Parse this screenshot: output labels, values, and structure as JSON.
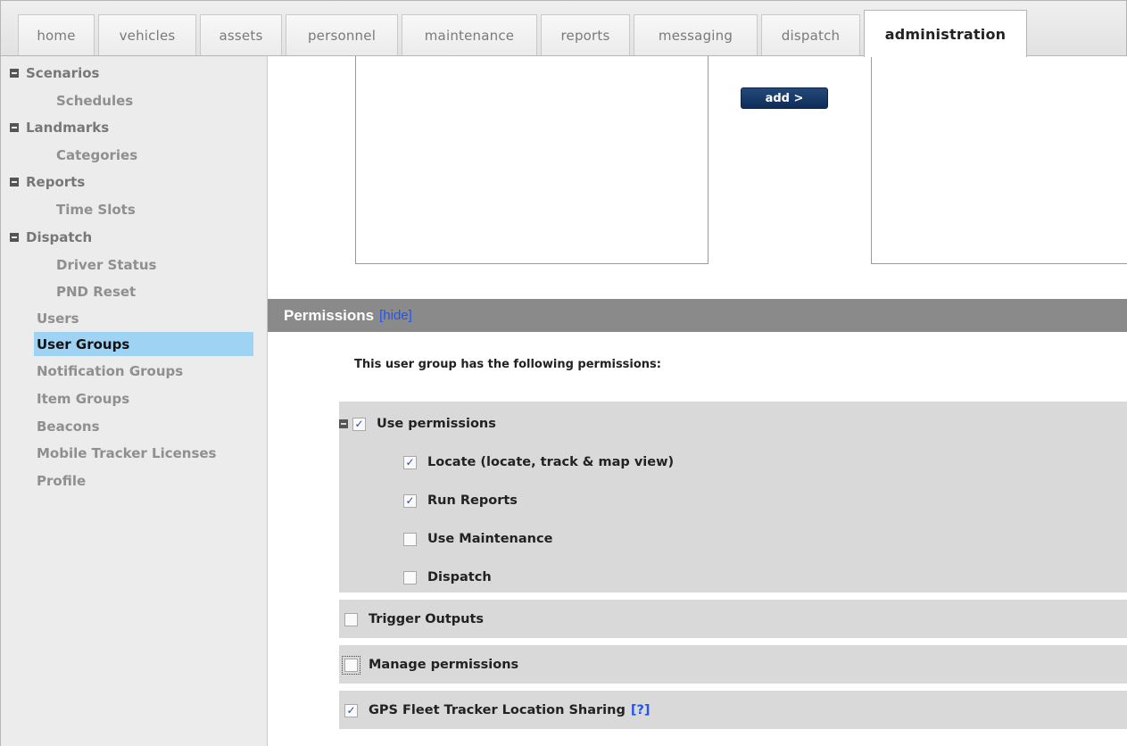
{
  "tabs": [
    {
      "label": "home"
    },
    {
      "label": "vehicles"
    },
    {
      "label": "assets"
    },
    {
      "label": "personnel"
    },
    {
      "label": "maintenance"
    },
    {
      "label": "reports"
    },
    {
      "label": "messaging"
    },
    {
      "label": "dispatch"
    },
    {
      "label": "administration",
      "active": true
    }
  ],
  "sidebar": {
    "groups": [
      {
        "label": "Scenarios",
        "children": [
          "Schedules"
        ]
      },
      {
        "label": "Landmarks",
        "children": [
          "Categories"
        ]
      },
      {
        "label": "Reports",
        "children": [
          "Time Slots"
        ]
      },
      {
        "label": "Dispatch",
        "children": [
          "Driver Status",
          "PND Reset"
        ]
      }
    ],
    "items": [
      "Users",
      "User Groups",
      "Notification Groups",
      "Item Groups",
      "Beacons",
      "Mobile Tracker Licenses",
      "Profile"
    ],
    "selected": "User Groups"
  },
  "main": {
    "add_button": "add >",
    "permissions": {
      "title": "Permissions",
      "hide_link": "[hide]",
      "intro": "This user group has the following permissions:",
      "use_permissions": {
        "label": "Use permissions",
        "checked": true,
        "children": [
          {
            "label": "Locate (locate, track & map view)",
            "checked": true
          },
          {
            "label": "Run Reports",
            "checked": true
          },
          {
            "label": "Use Maintenance",
            "checked": false
          },
          {
            "label": "Dispatch",
            "checked": false
          }
        ]
      },
      "trigger_outputs": {
        "label": "Trigger Outputs",
        "checked": false
      },
      "manage_permissions": {
        "label": "Manage permissions",
        "checked": false
      },
      "location_sharing": {
        "label": "GPS Fleet Tracker Location Sharing",
        "checked": true,
        "help": "[?]"
      }
    }
  },
  "colors": {
    "selected_bg": "#9fd3f4",
    "header_bg": "#8a8a8a",
    "button_bg": "#1a3c6b",
    "link": "#2255ee"
  }
}
